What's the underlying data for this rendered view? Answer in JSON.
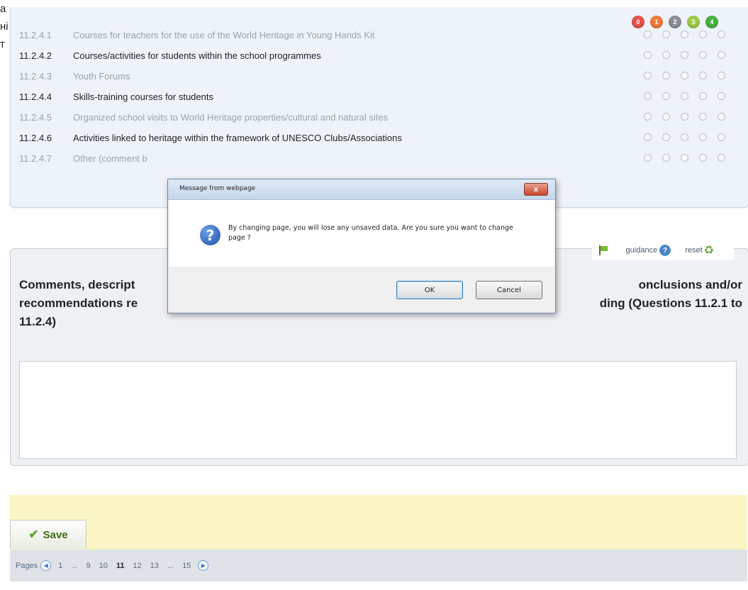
{
  "edge_text": [
    "a",
    "ні",
    "т"
  ],
  "score_header": [
    {
      "label": "0",
      "color": "#e9524a"
    },
    {
      "label": "1",
      "color": "#f07a3a"
    },
    {
      "label": "2",
      "color": "#8a9096"
    },
    {
      "label": "3",
      "color": "#9ccc45"
    },
    {
      "label": "4",
      "color": "#48b23f"
    }
  ],
  "rows": [
    {
      "number": "11.2.4.1",
      "label": "Courses for teachers for the use of the World Heritage in Young Hands Kit",
      "style": "dim"
    },
    {
      "number": "11.2.4.2",
      "label": "Courses/activities for students within the school programmes",
      "style": "dark"
    },
    {
      "number": "11.2.4.3",
      "label": "Youth Forums",
      "style": "dim"
    },
    {
      "number": "11.2.4.4",
      "label": "Skills-training courses for students",
      "style": "dark"
    },
    {
      "number": "11.2.4.5",
      "label": "Organized school visits to World Heritage properties/cultural and natural sites",
      "style": "dim"
    },
    {
      "number": "11.2.4.6",
      "label": "Activities linked to heritage within the framework of UNESCO Clubs/Associations",
      "style": "dark"
    },
    {
      "number": "11.2.4.7",
      "label": "Other (comment b",
      "style": "dim"
    }
  ],
  "tools": {
    "guidance": "guidance",
    "reset": "reset"
  },
  "comment": {
    "heading_left": "Comments, descript",
    "heading_right": "onclusions and/or",
    "heading_line2_left": "recommendations re",
    "heading_line2_right": "ding (Questions 11.2.1 to",
    "heading_line3": "11.2.4)"
  },
  "save": {
    "label": "Save"
  },
  "pager": {
    "label": "Pages",
    "items": [
      "1",
      "...",
      "9",
      "10",
      "11",
      "12",
      "13",
      "...",
      "15"
    ],
    "current": "11"
  },
  "dialog": {
    "title": "Message from webpage",
    "message": "By changing page, you will lose any unsaved data. Are you sure you want to change page ?",
    "ok": "OK",
    "cancel": "Cancel",
    "close": "x"
  }
}
